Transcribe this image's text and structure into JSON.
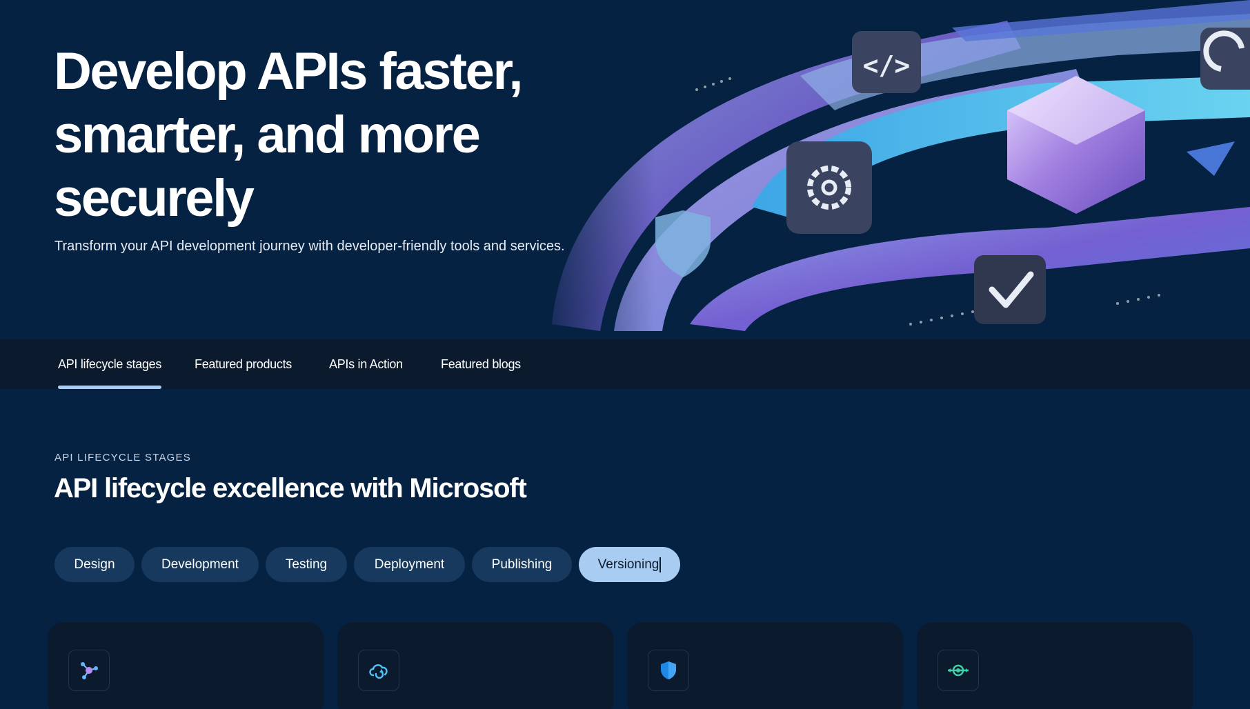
{
  "hero": {
    "title_lines": [
      "Develop APIs faster,",
      "smarter, and more",
      "securely"
    ],
    "subtitle": "Transform your API development journey with developer-friendly tools and services."
  },
  "tabs": [
    {
      "label": "API lifecycle stages",
      "active": true
    },
    {
      "label": "Featured products",
      "active": false
    },
    {
      "label": "APIs in Action",
      "active": false
    },
    {
      "label": "Featured blogs",
      "active": false
    }
  ],
  "section": {
    "eyebrow": "API LIFECYCLE STAGES",
    "title": "API lifecycle excellence with Microsoft"
  },
  "stages": [
    {
      "label": "Design",
      "selected": false
    },
    {
      "label": "Development",
      "selected": false
    },
    {
      "label": "Testing",
      "selected": false
    },
    {
      "label": "Deployment",
      "selected": false
    },
    {
      "label": "Publishing",
      "selected": false
    },
    {
      "label": "Versioning",
      "selected": true
    }
  ],
  "cards": [
    {
      "icon": "network-nodes-icon"
    },
    {
      "icon": "cloud-sync-icon"
    },
    {
      "icon": "shield-icon"
    },
    {
      "icon": "target-connection-icon"
    }
  ],
  "colors": {
    "page_bg": "#052243",
    "tabbar_bg": "#0c1a2e",
    "pill_bg": "#17395d",
    "accent": "#a9cdf2"
  }
}
